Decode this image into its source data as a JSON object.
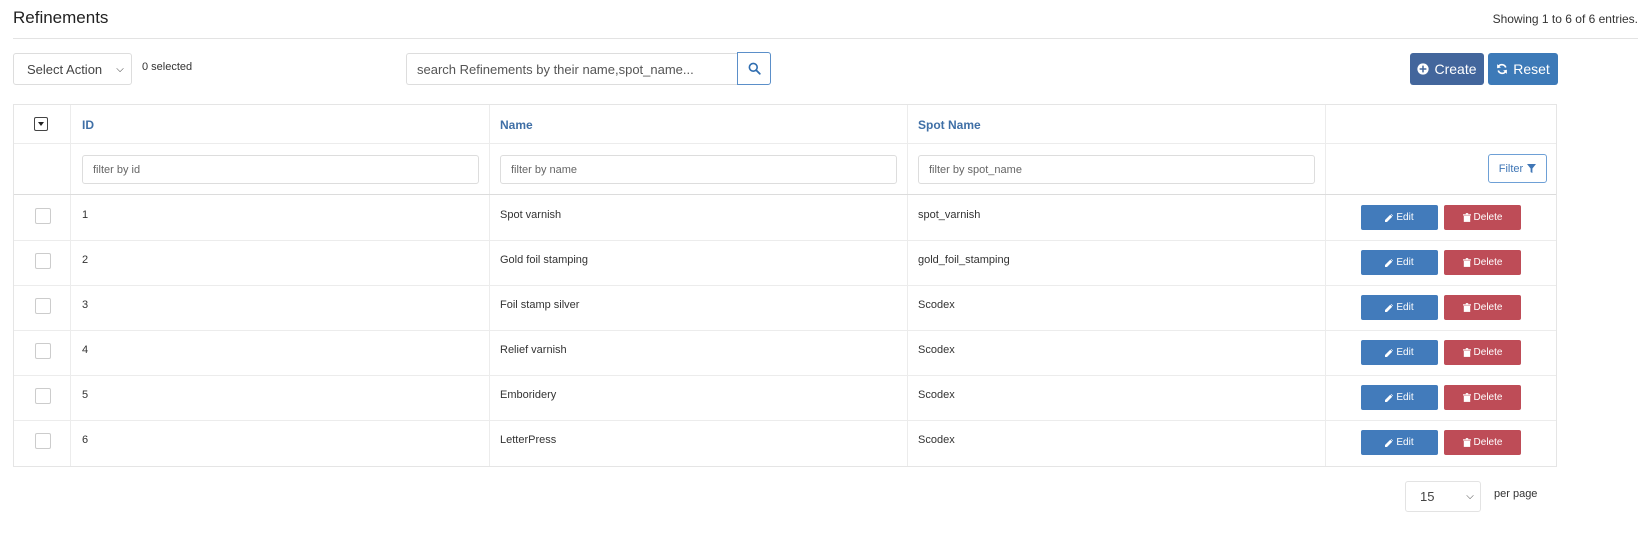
{
  "header": {
    "title": "Refinements",
    "summary": "Showing 1 to 6 of 6 entries."
  },
  "toolbar": {
    "select_action": "Select Action",
    "selected_count": "0 selected",
    "search_placeholder": "search Refinements by their name,spot_name...",
    "create_label": "Create",
    "reset_label": "Reset"
  },
  "table": {
    "columns": {
      "id": "ID",
      "name": "Name",
      "spot_name": "Spot Name"
    },
    "filters": {
      "id": "filter by id",
      "name": "filter by name",
      "spot_name": "filter by spot_name",
      "button": "Filter"
    },
    "rows": [
      {
        "id": "1",
        "name": "Spot varnish",
        "spot_name": "spot_varnish"
      },
      {
        "id": "2",
        "name": "Gold foil stamping",
        "spot_name": "gold_foil_stamping"
      },
      {
        "id": "3",
        "name": "Foil stamp silver",
        "spot_name": "Scodex"
      },
      {
        "id": "4",
        "name": "Relief varnish",
        "spot_name": "Scodex"
      },
      {
        "id": "5",
        "name": "Emboridery",
        "spot_name": "Scodex"
      },
      {
        "id": "6",
        "name": "LetterPress",
        "spot_name": "Scodex"
      }
    ],
    "row_actions": {
      "edit": "Edit",
      "delete": "Delete"
    }
  },
  "pagination": {
    "per_page_value": "15",
    "per_page_label": "per page"
  },
  "colors": {
    "create": "#43669c",
    "reset": "#3d7ab8",
    "edit": "#427bbb",
    "delete": "#be4c57",
    "header_link": "#3f6fa6"
  }
}
